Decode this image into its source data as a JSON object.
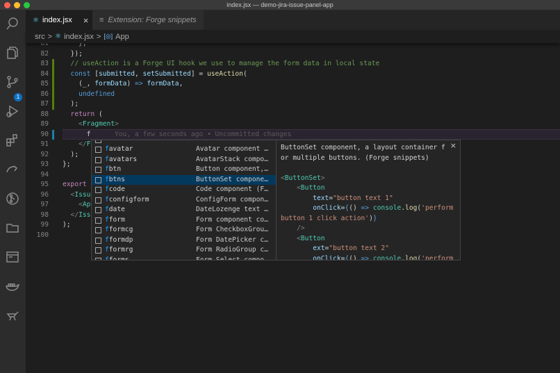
{
  "window": {
    "title": "index.jsx — demo-jira-issue-panel-app"
  },
  "tabs": [
    {
      "label": "index.jsx",
      "close": "×"
    },
    {
      "label": "Extension: Forge snippets"
    }
  ],
  "breadcrumb": {
    "folder": "src",
    "sep": ">",
    "file": "index.jsx",
    "symbol": "App"
  },
  "activity": {
    "source_control_badge": "1"
  },
  "lines": [
    {
      "n": "81",
      "tokens": [
        [
          "    };",
          "b"
        ]
      ]
    },
    {
      "n": "82",
      "tokens": [
        [
          "  });",
          "b"
        ]
      ]
    },
    {
      "n": "83",
      "tokens": [
        [
          "  // useAction is a Forge UI hook we use to manage the form data in local state",
          "c"
        ]
      ]
    },
    {
      "n": "84",
      "tokens": [
        [
          "  const ",
          "k"
        ],
        [
          "[",
          "b"
        ],
        [
          "submitted",
          "v"
        ],
        [
          ", ",
          "b"
        ],
        [
          "setSubmitted",
          "v"
        ],
        [
          "] = ",
          "b"
        ],
        [
          "useAction",
          "f"
        ],
        [
          "(",
          "b"
        ]
      ]
    },
    {
      "n": "85",
      "tokens": [
        [
          "    (_, ",
          "b"
        ],
        [
          "formData",
          "v"
        ],
        [
          ") ",
          "b"
        ],
        [
          "=>",
          "k"
        ],
        [
          " ",
          "b"
        ],
        [
          "formData",
          "v"
        ],
        [
          ",",
          "b"
        ]
      ]
    },
    {
      "n": "86",
      "tokens": [
        [
          "    undefined",
          "k"
        ]
      ]
    },
    {
      "n": "87",
      "tokens": [
        [
          "  );",
          "b"
        ]
      ]
    },
    {
      "n": "88",
      "tokens": [
        [
          "  return ",
          "p"
        ],
        [
          "(",
          "b"
        ]
      ]
    },
    {
      "n": "89",
      "tokens": [
        [
          "    <",
          "g"
        ],
        [
          "Fragment",
          "t"
        ],
        [
          ">",
          "g"
        ]
      ]
    },
    {
      "n": "90",
      "tokens": [
        [
          "      f",
          "b"
        ],
        [
          "      You, a few seconds ago • Uncommitted changes",
          "blame"
        ]
      ]
    },
    {
      "n": "91",
      "tokens": [
        [
          "    </",
          "g"
        ],
        [
          "F",
          "t"
        ]
      ]
    },
    {
      "n": "92",
      "tokens": [
        [
          "  );",
          "b"
        ]
      ]
    },
    {
      "n": "93",
      "tokens": [
        [
          "};",
          "b"
        ]
      ]
    },
    {
      "n": "94",
      "tokens": [
        [
          "",
          "b"
        ]
      ]
    },
    {
      "n": "95",
      "tokens": [
        [
          "export",
          "p"
        ]
      ]
    },
    {
      "n": "96",
      "tokens": [
        [
          "  <",
          "g"
        ],
        [
          "Issu",
          "t"
        ]
      ]
    },
    {
      "n": "97",
      "tokens": [
        [
          "    <",
          "g"
        ],
        [
          "Ap",
          "t"
        ]
      ]
    },
    {
      "n": "98",
      "tokens": [
        [
          "  </",
          "g"
        ],
        [
          "Iss",
          "t"
        ]
      ]
    },
    {
      "n": "99",
      "tokens": [
        [
          ");",
          "b"
        ]
      ]
    },
    {
      "n": "100",
      "tokens": [
        [
          "",
          "b"
        ]
      ]
    }
  ],
  "suggestions": [
    {
      "match": "f",
      "rest": "avatar",
      "detail": "Avatar component …"
    },
    {
      "match": "f",
      "rest": "avatars",
      "detail": "AvatarStack compo…"
    },
    {
      "match": "f",
      "rest": "btn",
      "detail": "Button component,…"
    },
    {
      "match": "f",
      "rest": "btns",
      "detail": "ButtonSet compone…",
      "selected": true
    },
    {
      "match": "f",
      "rest": "code",
      "detail": "Code component (F…"
    },
    {
      "match": "f",
      "rest": "configform",
      "detail": "ConfigForm compon…"
    },
    {
      "match": "f",
      "rest": "date",
      "detail": "DateLozenge text …"
    },
    {
      "match": "f",
      "rest": "form",
      "detail": "Form component co…"
    },
    {
      "match": "f",
      "rest": "formcg",
      "detail": "Form CheckboxGrou…"
    },
    {
      "match": "f",
      "rest": "formdp",
      "detail": "Form DatePicker c…"
    },
    {
      "match": "f",
      "rest": "formrg",
      "detail": "Form RadioGroup c…"
    },
    {
      "match": "f",
      "rest": "forms",
      "detail": "Form Select compo…"
    }
  ],
  "docs": {
    "close": "×",
    "lines": [
      [
        [
          "ButtonSet component, a layout container f",
          "b"
        ]
      ],
      [
        [
          "or multiple buttons. (Forge snippets)",
          "b"
        ]
      ],
      [
        [
          "",
          "b"
        ]
      ],
      [
        [
          "<",
          "g"
        ],
        [
          "ButtonSet",
          "t"
        ],
        [
          ">",
          "g"
        ]
      ],
      [
        [
          "    <",
          "g"
        ],
        [
          "Button",
          "t"
        ]
      ],
      [
        [
          "        text",
          "v"
        ],
        [
          "=",
          "b"
        ],
        [
          "\"button text 1\"",
          "s"
        ]
      ],
      [
        [
          "        onClick",
          "v"
        ],
        [
          "=",
          "b"
        ],
        [
          "{",
          "k"
        ],
        [
          "() ",
          "b"
        ],
        [
          "=>",
          "k"
        ],
        [
          " console",
          "t"
        ],
        [
          ".",
          "b"
        ],
        [
          "log",
          "f"
        ],
        [
          "(",
          "b"
        ],
        [
          "'perform",
          "s"
        ]
      ],
      [
        [
          "button 1 click action'",
          "s"
        ],
        [
          ")",
          "b"
        ],
        [
          "}",
          "k"
        ]
      ],
      [
        [
          "    />",
          "g"
        ]
      ],
      [
        [
          "    <",
          "g"
        ],
        [
          "Button",
          "t"
        ]
      ],
      [
        [
          "        ext",
          "v"
        ],
        [
          "=",
          "b"
        ],
        [
          "\"button text 2\"",
          "s"
        ]
      ],
      [
        [
          "        onClick",
          "v"
        ],
        [
          "=",
          "b"
        ],
        [
          "{",
          "k"
        ],
        [
          "() ",
          "b"
        ],
        [
          "=>",
          "k"
        ],
        [
          " console",
          "t"
        ],
        [
          ".",
          "b"
        ],
        [
          "log",
          "f"
        ],
        [
          "(",
          "b"
        ],
        [
          "'perform",
          "s"
        ]
      ]
    ]
  }
}
